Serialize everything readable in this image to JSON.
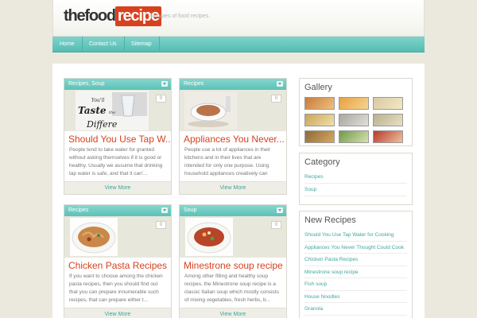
{
  "header": {
    "logo_the": "the",
    "logo_food": "food",
    "logo_recipe": "recipe",
    "tagline": "All types of food recipes."
  },
  "nav": {
    "items": [
      {
        "label": "Home"
      },
      {
        "label": "Contact Us"
      },
      {
        "label": "Sitemap"
      }
    ]
  },
  "posts": [
    {
      "category": "Recipes, Soup",
      "comments": "0",
      "title": "Should You Use Tap W...",
      "excerpt": "People tend to take water for granted without asking themselves if it is good or healthy. Usually we assume that drinking tap water is safe, and that it can'...",
      "view_more": "View More",
      "thumb_text": "You'll Taste the Difference"
    },
    {
      "category": "Recipes",
      "comments": "0",
      "title": "Appliances You Never...",
      "excerpt": "People use a lot of appliances in their kitchens and in their lives that are intended for only one purpose. Using household appliances creatively can result ...",
      "view_more": "View More"
    },
    {
      "category": "Recipes",
      "comments": "0",
      "title": "Chicken Pasta Recipes",
      "excerpt": "If you want to choose among the chicken pasta recipes, then you should find out that you can prepare innumerable such recipes, that can prepare either t...",
      "view_more": "View More"
    },
    {
      "category": "Soup",
      "comments": "0",
      "title": "Minestrone soup recipe",
      "excerpt": "Among other filling and healthy soup recipes, the Minestrone soup recipe is a classic Italian soup which mostly consists of mixing vegetables, fresh herbs, b...",
      "view_more": "View More"
    }
  ],
  "sidebar": {
    "gallery_title": "Gallery",
    "category_title": "Category",
    "categories": [
      "Recipes",
      "Soup"
    ],
    "new_recipes_title": "New Recipes",
    "new_recipes": [
      "Should You Use Tap Water for Cooking",
      "Appliances You Never Thought Could Cook",
      "Chicken Pasta Recipes",
      "Minestrone soup recipe",
      "Fish soup",
      "House Noodles",
      "Granola"
    ]
  },
  "colors": {
    "accent_teal": "#5cc1b7",
    "title_red": "#d8411f"
  }
}
